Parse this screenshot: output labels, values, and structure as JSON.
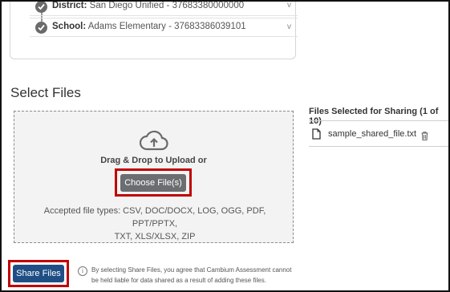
{
  "org": {
    "district": {
      "label": "District:",
      "value": "San Diego Unified - 37683380000000"
    },
    "school": {
      "label": "School:",
      "value": "Adams Elementary - 37683386039101"
    },
    "chevron": "v"
  },
  "select_files": {
    "title": "Select Files",
    "drag_drop_text": "Drag & Drop to Upload or",
    "choose_label": "Choose File(s)",
    "accepted_line1": "Accepted file types: CSV, DOC/DOCX, LOG, OGG, PDF, PPT/PPTX,",
    "accepted_line2": "TXT, XLS/XLSX, ZIP",
    "upload_icon": "cloud-upload-icon"
  },
  "selected": {
    "title": "Files Selected for Sharing (1 of 10)",
    "files": [
      {
        "name": "sample_shared_file.txt",
        "icon": "file-icon",
        "action_icon": "trash-icon"
      }
    ]
  },
  "footer": {
    "share_label": "Share Files",
    "info_icon": "i",
    "disclaimer": "By selecting Share Files, you agree that Cambium Assessment cannot be held liable for data shared as a result of adding these files."
  },
  "colors": {
    "share_button": "#1f4e85",
    "choose_button": "#6b6e70",
    "highlight": "#c00000"
  }
}
